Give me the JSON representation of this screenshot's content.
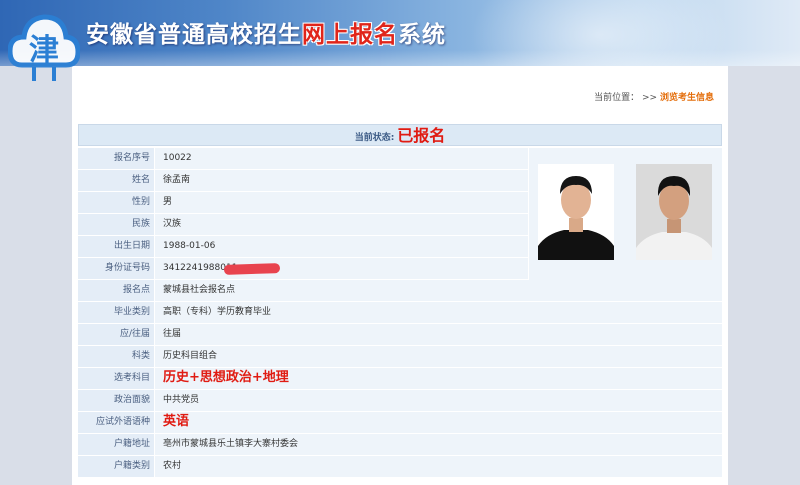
{
  "header": {
    "title_part1": "安徽省普通高校招生",
    "title_part2": "网上报名",
    "title_part3": "系统"
  },
  "logo": {
    "glyph": "津",
    "color": "#2b7fd4"
  },
  "breadcrumb": {
    "label": "当前位置：",
    "separator": ">>",
    "current": "浏览考生信息"
  },
  "status": {
    "label": "当前状态:",
    "value": "已报名"
  },
  "fields": [
    {
      "label": "报名序号",
      "value": "10022"
    },
    {
      "label": "姓名",
      "value": "徐孟南"
    },
    {
      "label": "性别",
      "value": "男"
    },
    {
      "label": "民族",
      "value": "汉族"
    },
    {
      "label": "出生日期",
      "value": "1988-01-06"
    },
    {
      "label": "身份证号码",
      "value": "3412241988011"
    },
    {
      "label": "报名点",
      "value": "蒙城县社会报名点"
    },
    {
      "label": "毕业类别",
      "value": "高职（专科）学历教育毕业"
    },
    {
      "label": "应/往届",
      "value": "往届"
    },
    {
      "label": "科类",
      "value": "历史科目组合"
    },
    {
      "label": "选考科目",
      "value": "历史+思想政治+地理"
    },
    {
      "label": "政治面貌",
      "value": "中共党员"
    },
    {
      "label": "应试外语语种",
      "value": "英语"
    },
    {
      "label": "户籍地址",
      "value": "亳州市蒙城县乐土镇李大寨村委会"
    },
    {
      "label": "户籍类别",
      "value": "农村"
    }
  ],
  "colors": {
    "accent_red": "#e01b12",
    "label_bg": "#e4edf7",
    "value_bg": "#eef4fa",
    "breadcrumb_current": "#e46d0a"
  }
}
